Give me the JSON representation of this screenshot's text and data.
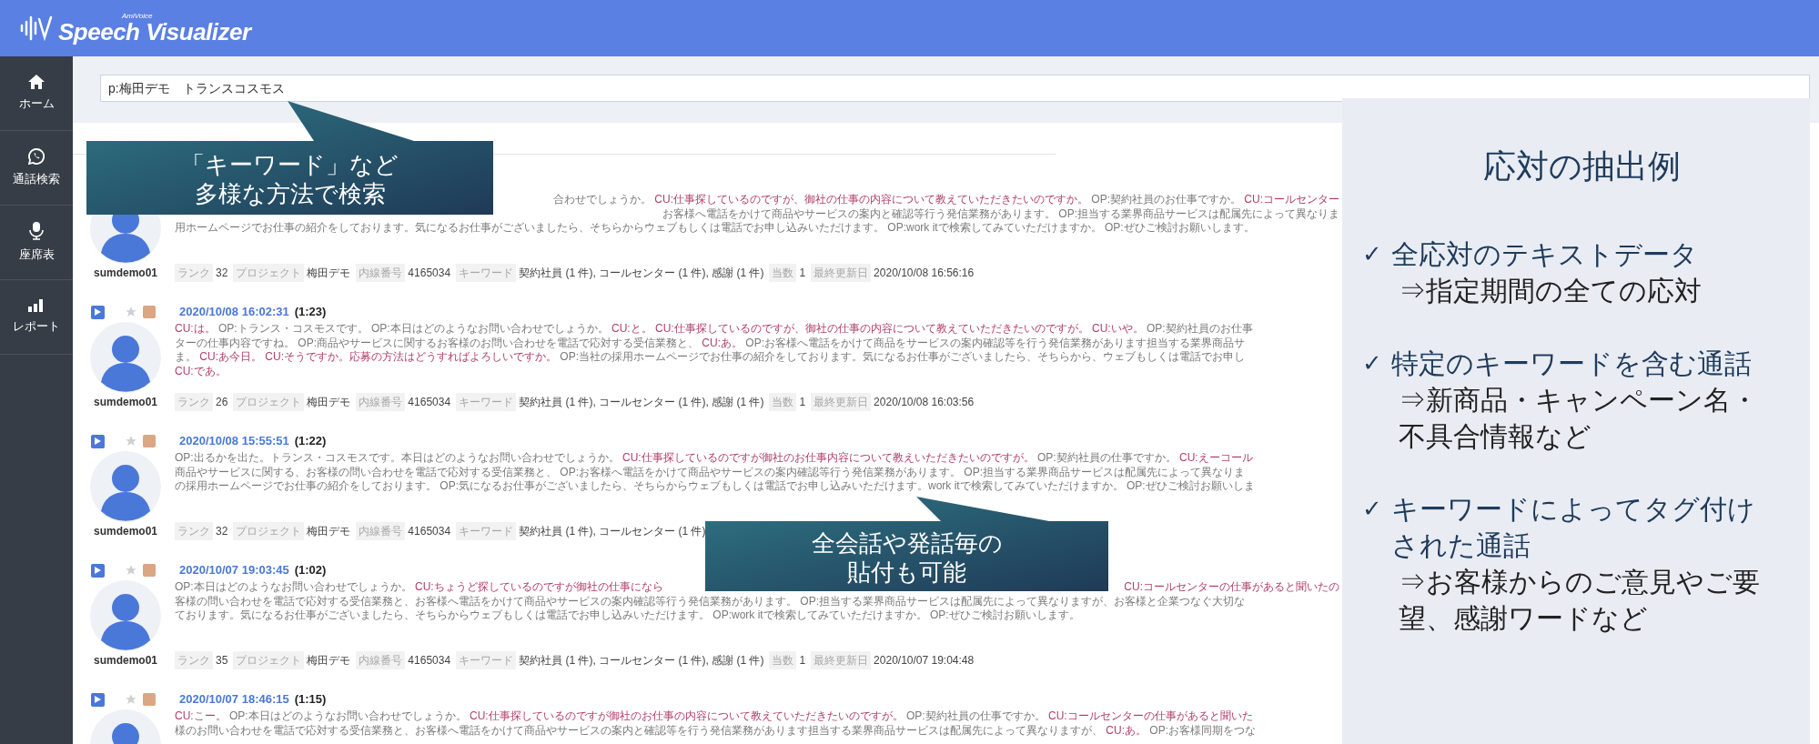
{
  "app": {
    "brand_small": "AmiVoice",
    "brand": "Speech Visualizer"
  },
  "sidebar": {
    "items": [
      {
        "kind": "home",
        "label": "ホーム"
      },
      {
        "kind": "chat",
        "label": "通話検索"
      },
      {
        "kind": "seat",
        "label": "座席表"
      },
      {
        "kind": "chart",
        "label": "レポート"
      }
    ]
  },
  "search": {
    "value": "p:梅田デモ　トランスコスモス"
  },
  "records": [
    {
      "user": "sumdemo01",
      "lines": [
        [
          {
            "kind": "covered"
          },
          {
            "kind": "op",
            "text": "合わせでしょうか。 "
          },
          {
            "kind": "cu",
            "text": "CU:仕事探しているのですが、御社の仕事の内容について教えていただきたいのですか。 "
          },
          {
            "kind": "op",
            "text": "OP:契約社員のお仕事ですか。 "
          },
          {
            "kind": "cu",
            "text": "CU:コールセンター"
          }
        ],
        [
          {
            "kind": "covered"
          },
          {
            "kind": "op",
            "text": "お客様へ電話をかけて商品やサービスの案内と確認等行う発信業務があります。 OP:担当する業界商品サービスは配属先によって異なりま"
          }
        ],
        [
          {
            "kind": "op",
            "text": "用ホームページでお仕事の紹介をしております。気になるお仕事がございましたら、そちらからウェブもしくは電話でお申し込みいただけます。 OP:work itで検索してみていただけますか。 OP:ぜひご検討お願いします。"
          }
        ]
      ],
      "meta": [
        {
          "label": "ランク",
          "value": "32"
        },
        {
          "label": "プロジェクト",
          "value": "梅田デモ"
        },
        {
          "label": "内線番号",
          "value": "4165034"
        },
        {
          "label": "キーワード",
          "value": "契約社員 (1 件), コールセンター (1 件), 感謝 (1 件)"
        },
        {
          "label": "当数",
          "value": "1"
        },
        {
          "label": "最終更新日",
          "value": "2020/10/08 16:56:16"
        }
      ]
    },
    {
      "date": "2020/10/08 16:02:31",
      "duration": "(1:23)",
      "user": "sumdemo01",
      "starred": false,
      "lines": [
        [
          {
            "kind": "cu",
            "text": "CU:は。 "
          },
          {
            "kind": "op",
            "text": "OP:トランス・コスモスです。 OP:本日はどのようなお問い合わせでしょうか。 "
          },
          {
            "kind": "cu",
            "text": "CU:と。 CU:仕事探しているのですが、御社の仕事の内容について教えていただきたいのですが。 CU:いや。 "
          },
          {
            "kind": "op",
            "text": "OP:契約社員のお仕事"
          }
        ],
        [
          {
            "kind": "op",
            "text": "ターの仕事内容ですね。 OP:商品やサービスに関するお客様のお問い合わせを電話で応対する受信業務と、 "
          },
          {
            "kind": "cu",
            "text": "CU:あ。 "
          },
          {
            "kind": "op",
            "text": "OP:お客様へ電話をかけて商品をサービスの案内確認等を行う発信業務があります担当する業界商品サ"
          }
        ],
        [
          {
            "kind": "op",
            "text": "ま。 "
          },
          {
            "kind": "cu",
            "text": "CU:あ今日。 CU:そうですか。応募の方法はどうすればよろしいですか。 "
          },
          {
            "kind": "op",
            "text": "OP:当社の採用ホームページでお仕事の紹介をしております。気になるお仕事がございましたら、そちらから、ウェブもしくは電話でお申し"
          }
        ],
        [
          {
            "kind": "cu",
            "text": "CU:であ。"
          }
        ]
      ],
      "meta": [
        {
          "label": "ランク",
          "value": "26"
        },
        {
          "label": "プロジェクト",
          "value": "梅田デモ"
        },
        {
          "label": "内線番号",
          "value": "4165034"
        },
        {
          "label": "キーワード",
          "value": "契約社員 (1 件), コールセンター (1 件), 感謝 (1 件)"
        },
        {
          "label": "当数",
          "value": "1"
        },
        {
          "label": "最終更新日",
          "value": "2020/10/08 16:03:56"
        }
      ]
    },
    {
      "date": "2020/10/08 15:55:51",
      "duration": "(1:22)",
      "user": "sumdemo01",
      "starred": false,
      "lines": [
        [
          {
            "kind": "op",
            "text": "OP:出るかを出た。トランス・コスモスです。本日はどのようなお問い合わせでしょうか。 "
          },
          {
            "kind": "cu",
            "text": "CU:仕事探しているのですが御社のお仕事内容について教えいただきたいのですが。 "
          },
          {
            "kind": "op",
            "text": "OP:契約社員の仕事ですか。 "
          },
          {
            "kind": "cu",
            "text": "CU:えーコール"
          }
        ],
        [
          {
            "kind": "op",
            "text": "商品やサービスに関する、お客様の問い合わせを電話で応対する受信業務と、 OP:お客様へ電話をかけて商品やサービスの案内確認等行う発信業務があります。 OP:担当する業界商品サービスは配属先によって異なりま"
          }
        ],
        [
          {
            "kind": "op",
            "text": "の採用ホームページでお仕事の紹介をしております。 OP:気になるお仕事がございましたら、そちらからウェブもしくは電話でお申し込みいただけます。work itで検索してみていただけますか。 OP:ぜひご検討お願いしま"
          }
        ]
      ],
      "meta": [
        {
          "label": "ランク",
          "value": "32"
        },
        {
          "label": "プロジェクト",
          "value": "梅田デモ"
        },
        {
          "label": "内線番号",
          "value": "4165034"
        },
        {
          "label": "キーワード",
          "value": "契約社員 (1 件), コールセンター (1 件)"
        }
      ]
    },
    {
      "date": "2020/10/07 19:03:45",
      "duration": "(1:02)",
      "user": "sumdemo01",
      "starred": false,
      "lines": [
        [
          {
            "kind": "op",
            "text": "OP:本日はどのようなお問い合わせでしょうか。 "
          },
          {
            "kind": "cu",
            "text": "CU:ちょうど探しているのですが御社の仕事になら"
          },
          {
            "kind": "covered"
          },
          {
            "kind": "cu",
            "text": "CU:コールセンターの仕事があると聞いたの"
          }
        ],
        [
          {
            "kind": "op",
            "text": "客様の問い合わせを電話で応対する受信業務と、お客様へ電話をかけて商品やサービスの案内確認等行う発信業務があります。 OP:担当する業界商品サービスは配属先によって異なりますが、お客様と企業つなぐ大切な"
          }
        ],
        [
          {
            "kind": "op",
            "text": "ております。気になるお仕事がございましたら、そちらからウェブもしくは電話でお申し込みいただけます。 OP:work itで検索してみていただけますか。 OP:ぜひご検討お願いします。"
          }
        ]
      ],
      "meta": [
        {
          "label": "ランク",
          "value": "35"
        },
        {
          "label": "プロジェクト",
          "value": "梅田デモ"
        },
        {
          "label": "内線番号",
          "value": "4165034"
        },
        {
          "label": "キーワード",
          "value": "契約社員 (1 件), コールセンター (1 件), 感謝 (1 件)"
        },
        {
          "label": "当数",
          "value": "1"
        },
        {
          "label": "最終更新日",
          "value": "2020/10/07 19:04:48"
        }
      ]
    },
    {
      "date": "2020/10/07 18:46:15",
      "duration": "(1:15)",
      "starred": false,
      "lines": [
        [
          {
            "kind": "cu",
            "text": "CU:こー。 "
          },
          {
            "kind": "op",
            "text": "OP:本日はどのようなお問い合わせでしょうか。 "
          },
          {
            "kind": "cu",
            "text": "CU:仕事探しているのですが御社のお仕事の内容について教えていただきたいのですが。 "
          },
          {
            "kind": "op",
            "text": "OP:契約社員の仕事ですか。 "
          },
          {
            "kind": "cu",
            "text": "CU:コールセンターの仕事があると聞いた"
          }
        ],
        [
          {
            "kind": "op",
            "text": "様のお問い合わせを電話で応対する受信業務と、お客様へ電話をかけて商品やサービスの案内と確認等を行う発信業務があります担当する業界商品サービスは配属先によって異なりますが、 "
          },
          {
            "kind": "cu",
            "text": "CU:あ。 "
          },
          {
            "kind": "op",
            "text": "OP:お客様同期をつな"
          }
        ]
      ]
    }
  ],
  "callouts": [
    {
      "lines": [
        "「キーワード」など",
        "多様な方法で検索"
      ]
    },
    {
      "lines": [
        "全会話や発話毎の",
        "貼付も可能"
      ]
    }
  ],
  "panel": {
    "title": "応対の抽出例",
    "items": [
      {
        "bullet": "✓",
        "title": "全応対のテキストデータ",
        "detail": "⇒指定期間の全ての応対"
      },
      {
        "bullet": "✓",
        "title": "特定のキーワードを含む通話",
        "detail": "⇒新商品・キャンペーン名・不具合情報など"
      },
      {
        "bullet": "✓",
        "title": "キーワードによってタグ付けされた通話",
        "detail": "⇒お客様からのご意見やご要望、感謝ワードなど"
      }
    ]
  }
}
